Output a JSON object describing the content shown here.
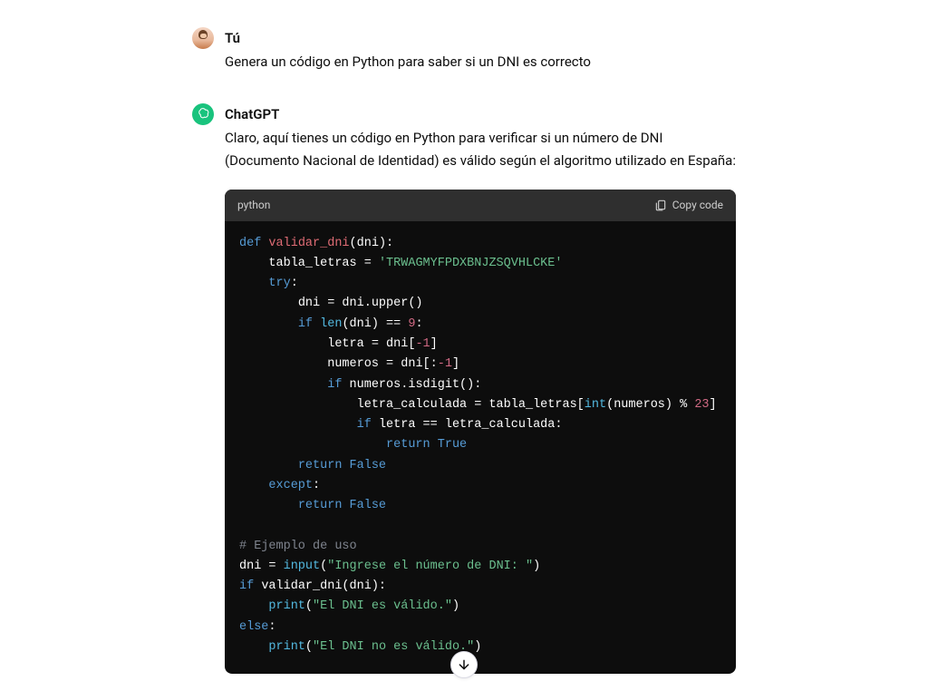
{
  "user": {
    "name": "Tú",
    "message": "Genera un código en Python para saber si un DNI es correcto"
  },
  "assistant": {
    "name": "ChatGPT",
    "message": "Claro, aquí tienes un código en Python para verificar si un número de DNI (Documento Nacional de Identidad) es válido según el algoritmo utilizado en España:"
  },
  "code": {
    "language": "python",
    "copy_label": "Copy code",
    "tokens": {
      "def": "def",
      "fn_validar": "validar_dni",
      "p_open": "(",
      "dni": "dni",
      "p_close": ")",
      "colon": ":",
      "tabla_letras": "tabla_letras",
      "eq": " = ",
      "str_tabla": "'TRWAGMYFPDXBNJZSQVHLCKE'",
      "try": "try",
      "dni_assign_l": "dni = dni.upper()",
      "if": "if",
      "len": "len",
      "eqeq9": " == ",
      "nine": "9",
      "letra": "letra",
      "slice_m1_open": " = dni[",
      "m1": "-1",
      "br_close": "]",
      "numeros": "numeros",
      "slice_colon_m1": " = dni[:",
      "isdigit": ".isdigit():",
      "dot_isdigit": "numeros",
      "letra_calc": "letra_calculada",
      "eq2": " = tabla_letras[",
      "int": "int",
      "pct": ") % ",
      "n23": "23",
      "eqeq": " == letra_calculada:",
      "letra_cmp": "letra",
      "return": "return",
      "true": "True",
      "false": "False",
      "except": "except",
      "comment": "# Ejemplo de uso",
      "input": "input",
      "input_str": "\"Ingrese el número de DNI: \"",
      "dni_eq_input": "dni = ",
      "if_validar": "validar_dni(dni):",
      "print": "print",
      "valido": "\"El DNI es válido.\"",
      "else": "else",
      "no_valido": "\"El DNI no es válido.\""
    }
  }
}
